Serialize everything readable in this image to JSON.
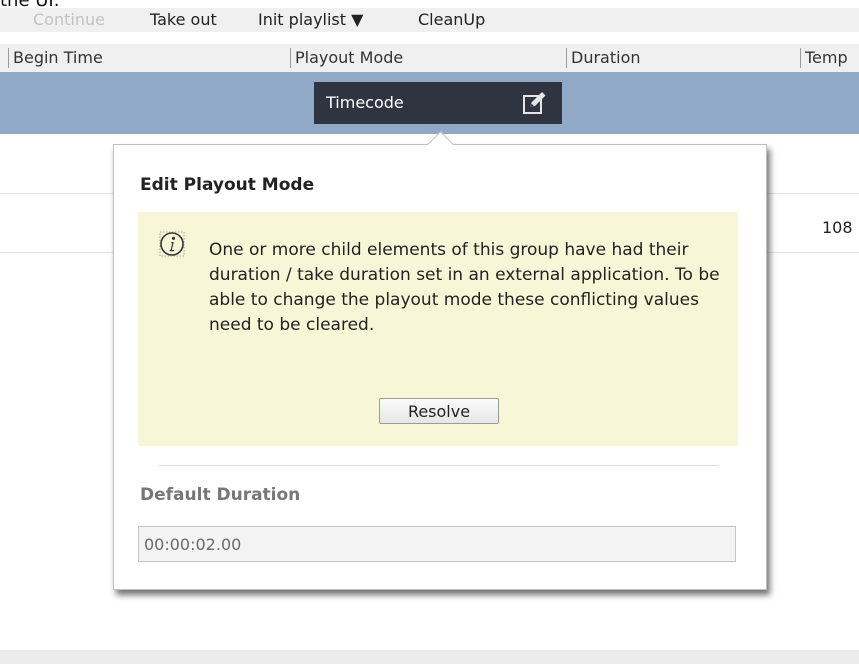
{
  "caption": "the UI.",
  "toolbar": {
    "continue_label": "Continue",
    "take_out_label": "Take out",
    "init_playlist_label": "Init playlist ▼",
    "cleanup_label": "CleanUp"
  },
  "columns": {
    "begin_time": "Begin Time",
    "playout_mode": "Playout Mode",
    "duration": "Duration",
    "temp": "Temp"
  },
  "row": {
    "playout_mode_value": "Timecode",
    "partial_value": "108"
  },
  "popup": {
    "title": "Edit Playout Mode",
    "warning_text": "One or more child elements of this group have had their duration / take duration set in an external application. To be able to change the playout mode these conflicting values need to be cleared.",
    "resolve_label": "Resolve",
    "default_duration_label": "Default Duration",
    "default_duration_value": "00:00:02.00"
  },
  "colors": {
    "selected_row": "#8fa9c6",
    "timecode_cell": "#2f3440",
    "warning_bg": "#f7f7d7"
  },
  "icons": {
    "edit": "edit-icon",
    "info": "info-icon"
  }
}
